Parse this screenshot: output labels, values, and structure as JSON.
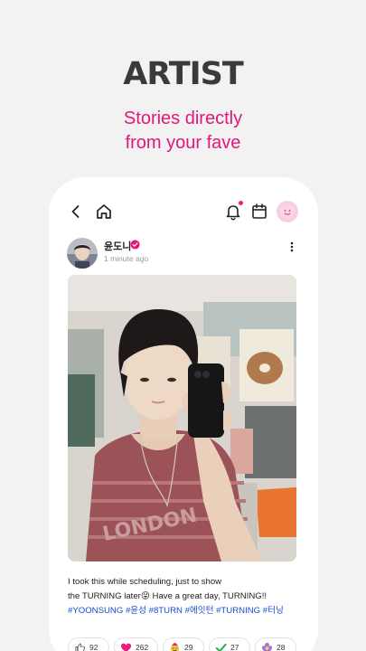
{
  "promo": {
    "title": "ARTIST",
    "subtitle_line1": "Stories directly",
    "subtitle_line2": "from your fave"
  },
  "colors": {
    "accent": "#e5157a",
    "hashtag": "#1a4bd1",
    "notification_dot": "#f2254e"
  },
  "topbar": {
    "icons": [
      "back-icon",
      "home-icon",
      "bell-icon",
      "calendar-icon",
      "profile-avatar"
    ],
    "has_notification": true
  },
  "post": {
    "author": "윤도니",
    "time": "1 minute ago",
    "text_line1": "I took this while scheduling, just to show",
    "text_line2": "the TURNING later😝 Have a great day, TURNING!!",
    "hashtags": "#YOONSUNG #윤성 #8TURN #에잇턴 #TURNING #터닝"
  },
  "reactions": [
    {
      "icon": "thumbs-up-icon",
      "count": "92"
    },
    {
      "icon": "heart-icon",
      "count": "262"
    },
    {
      "icon": "party-face-icon",
      "count": "29"
    },
    {
      "icon": "check-icon",
      "count": "27"
    },
    {
      "icon": "flower-icon",
      "count": "28"
    }
  ]
}
